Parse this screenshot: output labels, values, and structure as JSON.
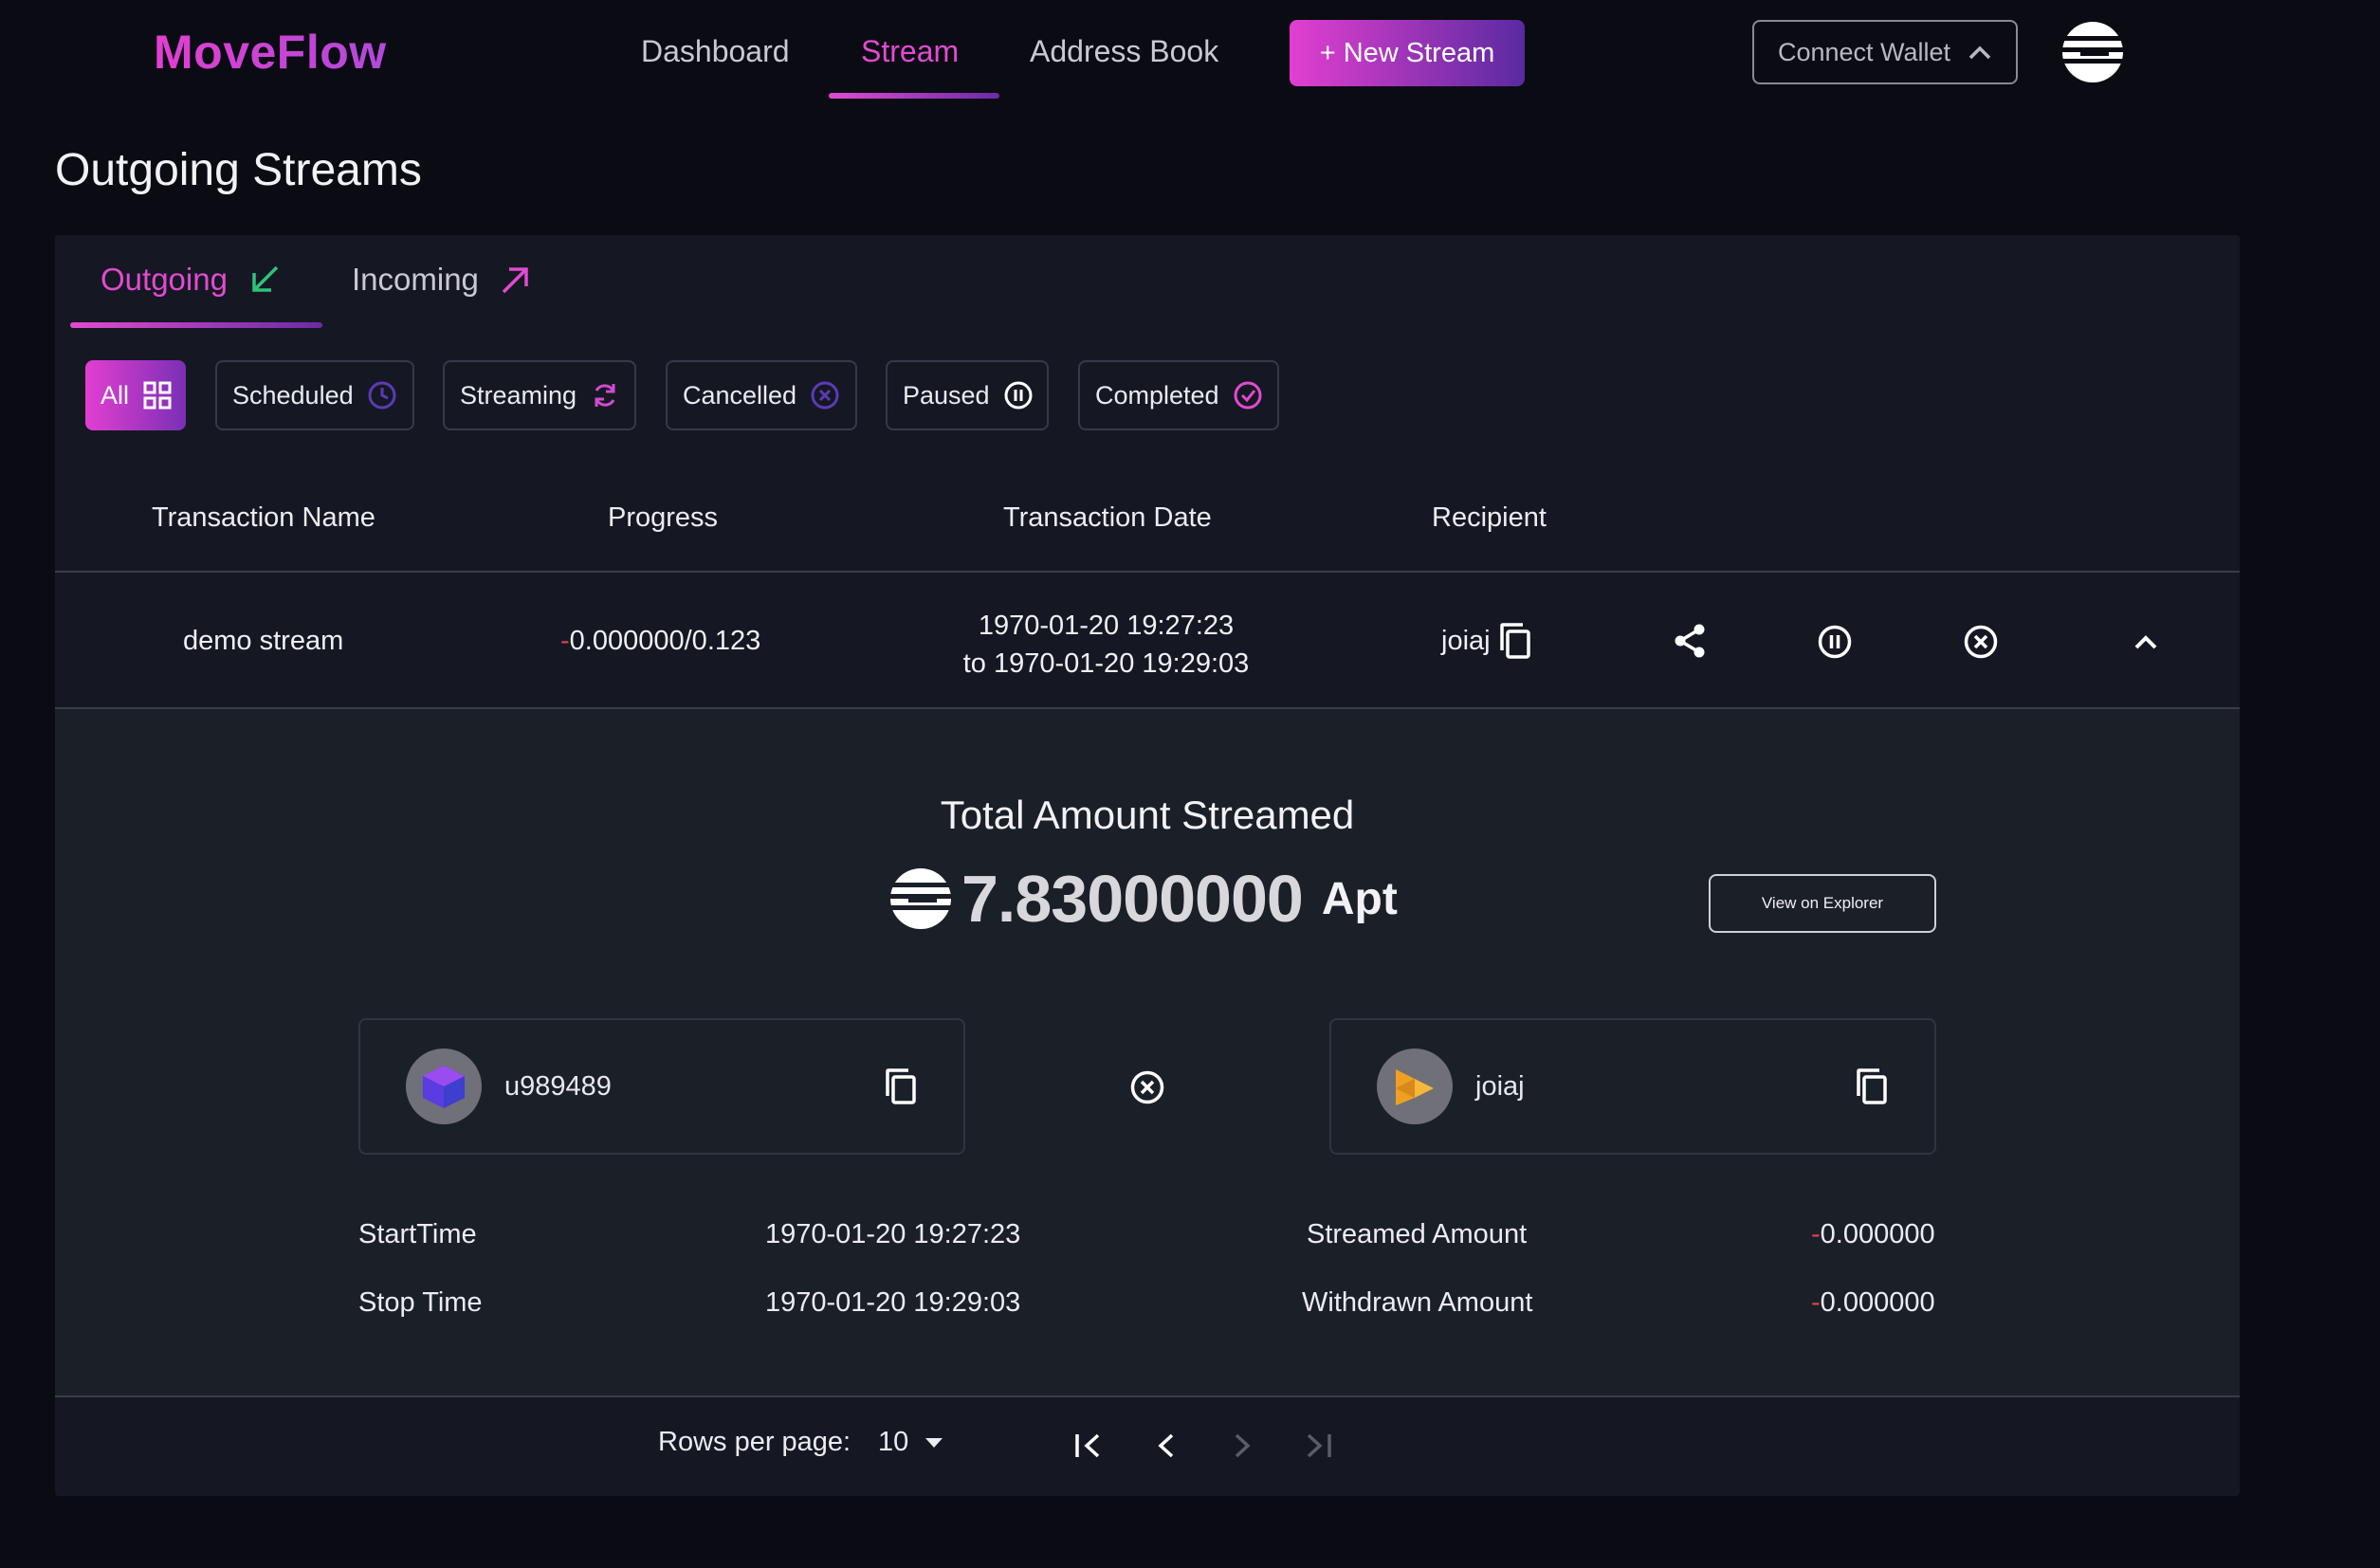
{
  "header": {
    "logo": "MoveFlow",
    "nav": [
      "Dashboard",
      "Stream",
      "Address Book"
    ],
    "active_nav": "Stream",
    "new_stream": "+ New Stream",
    "connect_wallet": "Connect Wallet"
  },
  "page": {
    "title": "Outgoing Streams"
  },
  "tabs": {
    "outgoing": "Outgoing",
    "incoming": "Incoming",
    "active": "Outgoing"
  },
  "filters": [
    {
      "label": "All",
      "icon": "grid-icon"
    },
    {
      "label": "Scheduled",
      "icon": "clock-icon"
    },
    {
      "label": "Streaming",
      "icon": "refresh-icon"
    },
    {
      "label": "Cancelled",
      "icon": "cancel-icon"
    },
    {
      "label": "Paused",
      "icon": "pause-icon"
    },
    {
      "label": "Completed",
      "icon": "check-icon"
    }
  ],
  "table": {
    "headers": [
      "Transaction Name",
      "Progress",
      "Transaction Date",
      "Recipient"
    ],
    "row": {
      "name": "demo stream",
      "progress_sign": "-",
      "progress": "0.000000/0.123",
      "date_from": "1970-01-20 19:27:23",
      "date_to": "to 1970-01-20 19:29:03",
      "recipient": "joiaj"
    }
  },
  "detail": {
    "total_title": "Total Amount Streamed",
    "total_amount": "7.83000000",
    "unit": "Apt",
    "explorer": "View on Explorer",
    "sender": "u989489",
    "receiver": "joiaj",
    "start_label": "StartTime",
    "start_value": "1970-01-20 19:27:23",
    "stop_label": "Stop Time",
    "stop_value": "1970-01-20 19:29:03",
    "streamed_label": "Streamed Amount",
    "streamed_value": "0.000000",
    "withdrawn_label": "Withdrawn Amount",
    "withdrawn_value": "0.000000",
    "sign": "-"
  },
  "pagination": {
    "rows_label": "Rows per page:",
    "rows_value": "10"
  },
  "colors": {
    "accent": "#e14bd0",
    "accent_dark": "#5a2aa0",
    "background": "#0b0b14",
    "card": "#151823",
    "negative": "#e04050",
    "incoming_arrow": "#e14bd0",
    "outgoing_arrow": "#2fc27a"
  }
}
